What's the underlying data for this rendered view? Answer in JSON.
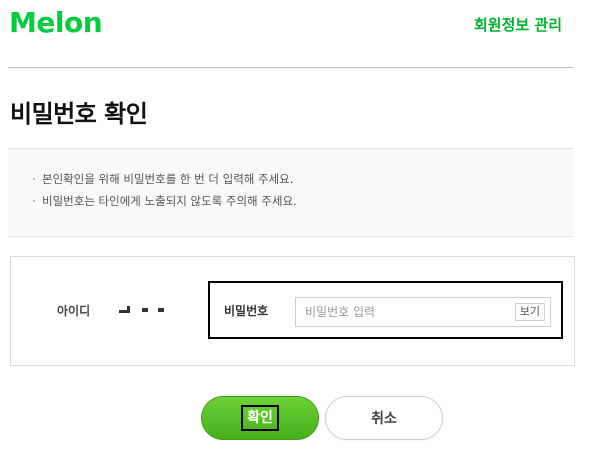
{
  "header": {
    "logo_text": "Melon",
    "manage_link": "회원정보 관리"
  },
  "page": {
    "title": "비밀번호 확인"
  },
  "notice": {
    "items": [
      "본인확인을 위해 비밀번호를 한 번 더 입력해 주세요.",
      "비밀번호는 타인에게 노출되지 않도록 주의해 주세요."
    ]
  },
  "form": {
    "id_label": "아이디",
    "password_label": "비밀번호",
    "password_value": "",
    "password_placeholder": "비밀번호 입력",
    "show_button": "보기"
  },
  "buttons": {
    "confirm": "확인",
    "cancel": "취소"
  },
  "colors": {
    "brand": "#00cd3c",
    "link": "#00b32d",
    "confirm_button": "#45b018"
  }
}
